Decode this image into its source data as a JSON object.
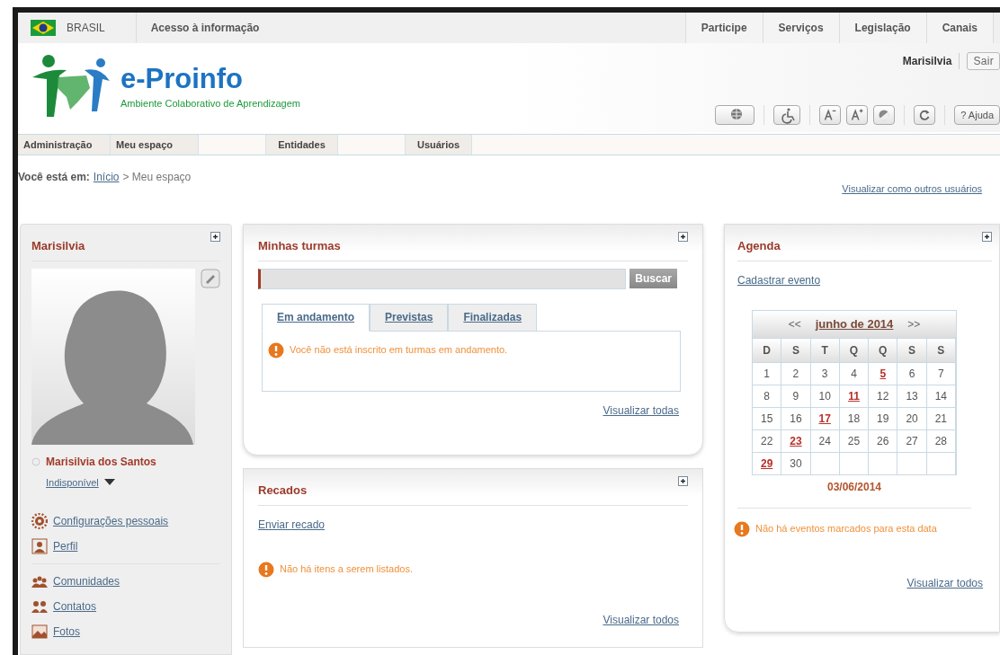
{
  "gov_bar": {
    "country": "BRASIL",
    "left_links": [
      "Acesso à informação"
    ],
    "right_links": [
      "Participe",
      "Serviços",
      "Legislação",
      "Canais"
    ]
  },
  "site": {
    "title": "e-Proinfo",
    "subtitle": "Ambiente Colaborativo de Aprendizagem"
  },
  "user_bar": {
    "user": "Marisilvia",
    "logout": "Sair"
  },
  "toolbar": {
    "help": "? Ajuda"
  },
  "menu": [
    {
      "kind": "item",
      "label": "Administração"
    },
    {
      "kind": "item",
      "label": "Meu espaço"
    },
    {
      "kind": "spacer"
    },
    {
      "kind": "item",
      "label": "Entidades"
    },
    {
      "kind": "spacer"
    },
    {
      "kind": "item",
      "label": "Usuários"
    }
  ],
  "breadcrumb": {
    "label": "Você está em:",
    "items": [
      {
        "text": "Início",
        "kind": "link"
      },
      {
        "text": "> Meu espaço",
        "kind": "text"
      }
    ]
  },
  "view_as": "Visualizar como outros usuários",
  "profile": {
    "title": "Marisilvia",
    "name": "Marisilvia dos Santos",
    "status": "Indisponível",
    "online": false,
    "groups": [
      [
        {
          "kind": "settings",
          "label": "Configurações pessoais"
        },
        {
          "kind": "profile",
          "label": "Perfil"
        }
      ],
      [
        {
          "kind": "communities",
          "label": "Comunidades"
        },
        {
          "kind": "contacts",
          "label": "Contatos"
        },
        {
          "kind": "photos",
          "label": "Fotos"
        }
      ]
    ]
  },
  "classes": {
    "title": "Minhas turmas",
    "search_button": "Buscar",
    "tabs": [
      {
        "label": "Em andamento",
        "selected": true
      },
      {
        "label": "Previstas",
        "selected": false
      },
      {
        "label": "Finalizadas",
        "selected": false
      }
    ],
    "message": "Você não está inscrito em turmas em andamento.",
    "view_all": "Visualizar todas"
  },
  "messages": {
    "title": "Recados",
    "send": "Enviar recado",
    "message": "Não há itens a serem listados.",
    "view_all": "Visualizar todos"
  },
  "agenda": {
    "title": "Agenda",
    "add_event": "Cadastrar evento",
    "prev": "<<",
    "month": "junho de 2014",
    "next": ">>",
    "weekdays": [
      "D",
      "S",
      "T",
      "Q",
      "Q",
      "S",
      "S"
    ],
    "weeks": [
      [
        {
          "day": "1",
          "event": false
        },
        {
          "day": "2",
          "event": false
        },
        {
          "day": "3",
          "event": false
        },
        {
          "day": "4",
          "event": false
        },
        {
          "day": "5",
          "event": true
        },
        {
          "day": "6",
          "event": false
        },
        {
          "day": "7",
          "event": false
        }
      ],
      [
        {
          "day": "8",
          "event": false
        },
        {
          "day": "9",
          "event": false
        },
        {
          "day": "10",
          "event": false
        },
        {
          "day": "11",
          "event": true
        },
        {
          "day": "12",
          "event": false
        },
        {
          "day": "13",
          "event": false
        },
        {
          "day": "14",
          "event": false
        }
      ],
      [
        {
          "day": "15",
          "event": false
        },
        {
          "day": "16",
          "event": false
        },
        {
          "day": "17",
          "event": true
        },
        {
          "day": "18",
          "event": false
        },
        {
          "day": "19",
          "event": false
        },
        {
          "day": "20",
          "event": false
        },
        {
          "day": "21",
          "event": false
        }
      ],
      [
        {
          "day": "22",
          "event": false
        },
        {
          "day": "23",
          "event": true
        },
        {
          "day": "24",
          "event": false
        },
        {
          "day": "25",
          "event": false
        },
        {
          "day": "26",
          "event": false
        },
        {
          "day": "27",
          "event": false
        },
        {
          "day": "28",
          "event": false
        }
      ],
      [
        {
          "day": "29",
          "event": true
        },
        {
          "day": "30",
          "event": false
        }
      ]
    ],
    "selected_date": "03/06/2014",
    "message": "Não há eventos marcados para esta data",
    "view_all": "Visualizar todos"
  }
}
